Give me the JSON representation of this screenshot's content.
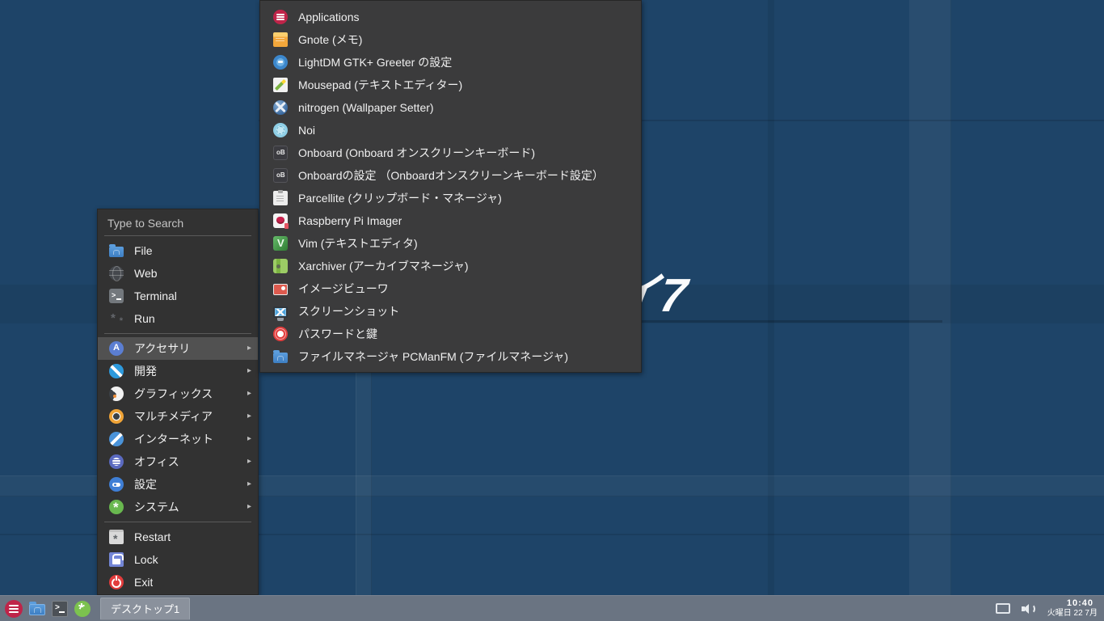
{
  "colors": {
    "menu_bg": "#323232",
    "submenu_bg": "#3b3b3c",
    "menu_highlight": "#515151",
    "menu_text": "#f0f0f0",
    "menu_muted": "#c4c4c4",
    "separator": "#5a5a5a",
    "taskbar_bg": "#6a7482",
    "desktop_button_bg": "#8a919c",
    "wallpaper_base": "#1e4468",
    "accent_red": "#bf2449"
  },
  "wallpaper": {
    "overlay_text": "イ7"
  },
  "main_menu": {
    "search_label": "Type to Search",
    "quick_items": [
      {
        "id": "file",
        "icon": "folder",
        "label": "File"
      },
      {
        "id": "web",
        "icon": "web",
        "label": "Web"
      },
      {
        "id": "terminal",
        "icon": "terminal",
        "label": "Terminal"
      },
      {
        "id": "run",
        "icon": "run",
        "label": "Run"
      }
    ],
    "categories": [
      {
        "id": "accessories",
        "icon": "accessories",
        "label": "アクセサリ",
        "selected": true,
        "arrow": true
      },
      {
        "id": "development",
        "icon": "development",
        "label": "開発",
        "arrow": true
      },
      {
        "id": "graphics",
        "icon": "graphics",
        "label": "グラフィックス",
        "arrow": true
      },
      {
        "id": "multimedia",
        "icon": "multimedia",
        "label": "マルチメディア",
        "arrow": true
      },
      {
        "id": "internet",
        "icon": "internet",
        "label": "インターネット",
        "arrow": true
      },
      {
        "id": "office",
        "icon": "office",
        "label": "オフィス",
        "arrow": true
      },
      {
        "id": "settings",
        "icon": "settings",
        "label": "設定",
        "arrow": true
      },
      {
        "id": "system",
        "icon": "system",
        "label": "システム",
        "arrow": true
      }
    ],
    "actions": [
      {
        "id": "restart",
        "icon": "restart",
        "label": "Restart"
      },
      {
        "id": "lock",
        "icon": "lock",
        "label": "Lock"
      },
      {
        "id": "exit",
        "icon": "exit",
        "label": "Exit"
      }
    ]
  },
  "submenu": {
    "items": [
      {
        "id": "applications",
        "icon": "applications",
        "label": "Applications"
      },
      {
        "id": "gnote",
        "icon": "gnote",
        "label": "Gnote (メモ)"
      },
      {
        "id": "lightdm-settings",
        "icon": "lightdm",
        "label": "LightDM GTK+ Greeter の設定"
      },
      {
        "id": "mousepad",
        "icon": "mousepad",
        "label": "Mousepad (テキストエディター)"
      },
      {
        "id": "nitrogen",
        "icon": "nitrogen",
        "label": "nitrogen (Wallpaper Setter)"
      },
      {
        "id": "noi",
        "icon": "noi",
        "label": "Noi"
      },
      {
        "id": "onboard",
        "icon": "onboard",
        "label": "Onboard (Onboard オンスクリーンキーボード)"
      },
      {
        "id": "onboard-settings",
        "icon": "onboard",
        "label": "Onboardの設定 （Onboardオンスクリーンキーボード設定）"
      },
      {
        "id": "parcellite",
        "icon": "parcellite",
        "label": "Parcellite (クリップボード・マネージャ)"
      },
      {
        "id": "rpi-imager",
        "icon": "rpi",
        "label": "Raspberry Pi Imager"
      },
      {
        "id": "vim",
        "icon": "vim",
        "label": "Vim (テキストエディタ)"
      },
      {
        "id": "xarchiver",
        "icon": "xarchiver",
        "label": "Xarchiver (アーカイブマネージャ)"
      },
      {
        "id": "image-viewer",
        "icon": "imageviewer",
        "label": "イメージビューワ"
      },
      {
        "id": "screenshot",
        "icon": "screenshot",
        "label": "スクリーンショット"
      },
      {
        "id": "passwords-keys",
        "icon": "passwords",
        "label": "パスワードと鍵"
      },
      {
        "id": "pcmanfm",
        "icon": "folder",
        "label": "ファイルマネージャ PCManFM (ファイルマネージャ)"
      }
    ]
  },
  "taskbar": {
    "desktop_button_label": "デスクトップ1",
    "clock_time": "10:40",
    "clock_date": "火曜日 22 7月"
  }
}
